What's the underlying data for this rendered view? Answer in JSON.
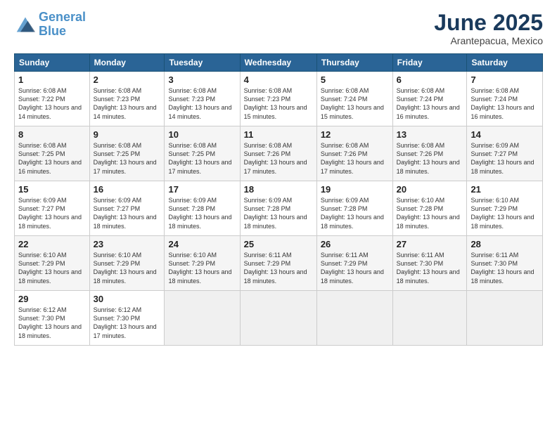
{
  "logo": {
    "line1": "General",
    "line2": "Blue"
  },
  "title": "June 2025",
  "subtitle": "Arantepacua, Mexico",
  "days_of_week": [
    "Sunday",
    "Monday",
    "Tuesday",
    "Wednesday",
    "Thursday",
    "Friday",
    "Saturday"
  ],
  "weeks": [
    [
      {
        "day": "1",
        "sunrise": "Sunrise: 6:08 AM",
        "sunset": "Sunset: 7:22 PM",
        "daylight": "Daylight: 13 hours and 14 minutes."
      },
      {
        "day": "2",
        "sunrise": "Sunrise: 6:08 AM",
        "sunset": "Sunset: 7:23 PM",
        "daylight": "Daylight: 13 hours and 14 minutes."
      },
      {
        "day": "3",
        "sunrise": "Sunrise: 6:08 AM",
        "sunset": "Sunset: 7:23 PM",
        "daylight": "Daylight: 13 hours and 14 minutes."
      },
      {
        "day": "4",
        "sunrise": "Sunrise: 6:08 AM",
        "sunset": "Sunset: 7:23 PM",
        "daylight": "Daylight: 13 hours and 15 minutes."
      },
      {
        "day": "5",
        "sunrise": "Sunrise: 6:08 AM",
        "sunset": "Sunset: 7:24 PM",
        "daylight": "Daylight: 13 hours and 15 minutes."
      },
      {
        "day": "6",
        "sunrise": "Sunrise: 6:08 AM",
        "sunset": "Sunset: 7:24 PM",
        "daylight": "Daylight: 13 hours and 16 minutes."
      },
      {
        "day": "7",
        "sunrise": "Sunrise: 6:08 AM",
        "sunset": "Sunset: 7:24 PM",
        "daylight": "Daylight: 13 hours and 16 minutes."
      }
    ],
    [
      {
        "day": "8",
        "sunrise": "Sunrise: 6:08 AM",
        "sunset": "Sunset: 7:25 PM",
        "daylight": "Daylight: 13 hours and 16 minutes."
      },
      {
        "day": "9",
        "sunrise": "Sunrise: 6:08 AM",
        "sunset": "Sunset: 7:25 PM",
        "daylight": "Daylight: 13 hours and 17 minutes."
      },
      {
        "day": "10",
        "sunrise": "Sunrise: 6:08 AM",
        "sunset": "Sunset: 7:25 PM",
        "daylight": "Daylight: 13 hours and 17 minutes."
      },
      {
        "day": "11",
        "sunrise": "Sunrise: 6:08 AM",
        "sunset": "Sunset: 7:26 PM",
        "daylight": "Daylight: 13 hours and 17 minutes."
      },
      {
        "day": "12",
        "sunrise": "Sunrise: 6:08 AM",
        "sunset": "Sunset: 7:26 PM",
        "daylight": "Daylight: 13 hours and 17 minutes."
      },
      {
        "day": "13",
        "sunrise": "Sunrise: 6:08 AM",
        "sunset": "Sunset: 7:26 PM",
        "daylight": "Daylight: 13 hours and 18 minutes."
      },
      {
        "day": "14",
        "sunrise": "Sunrise: 6:09 AM",
        "sunset": "Sunset: 7:27 PM",
        "daylight": "Daylight: 13 hours and 18 minutes."
      }
    ],
    [
      {
        "day": "15",
        "sunrise": "Sunrise: 6:09 AM",
        "sunset": "Sunset: 7:27 PM",
        "daylight": "Daylight: 13 hours and 18 minutes."
      },
      {
        "day": "16",
        "sunrise": "Sunrise: 6:09 AM",
        "sunset": "Sunset: 7:27 PM",
        "daylight": "Daylight: 13 hours and 18 minutes."
      },
      {
        "day": "17",
        "sunrise": "Sunrise: 6:09 AM",
        "sunset": "Sunset: 7:28 PM",
        "daylight": "Daylight: 13 hours and 18 minutes."
      },
      {
        "day": "18",
        "sunrise": "Sunrise: 6:09 AM",
        "sunset": "Sunset: 7:28 PM",
        "daylight": "Daylight: 13 hours and 18 minutes."
      },
      {
        "day": "19",
        "sunrise": "Sunrise: 6:09 AM",
        "sunset": "Sunset: 7:28 PM",
        "daylight": "Daylight: 13 hours and 18 minutes."
      },
      {
        "day": "20",
        "sunrise": "Sunrise: 6:10 AM",
        "sunset": "Sunset: 7:28 PM",
        "daylight": "Daylight: 13 hours and 18 minutes."
      },
      {
        "day": "21",
        "sunrise": "Sunrise: 6:10 AM",
        "sunset": "Sunset: 7:29 PM",
        "daylight": "Daylight: 13 hours and 18 minutes."
      }
    ],
    [
      {
        "day": "22",
        "sunrise": "Sunrise: 6:10 AM",
        "sunset": "Sunset: 7:29 PM",
        "daylight": "Daylight: 13 hours and 18 minutes."
      },
      {
        "day": "23",
        "sunrise": "Sunrise: 6:10 AM",
        "sunset": "Sunset: 7:29 PM",
        "daylight": "Daylight: 13 hours and 18 minutes."
      },
      {
        "day": "24",
        "sunrise": "Sunrise: 6:10 AM",
        "sunset": "Sunset: 7:29 PM",
        "daylight": "Daylight: 13 hours and 18 minutes."
      },
      {
        "day": "25",
        "sunrise": "Sunrise: 6:11 AM",
        "sunset": "Sunset: 7:29 PM",
        "daylight": "Daylight: 13 hours and 18 minutes."
      },
      {
        "day": "26",
        "sunrise": "Sunrise: 6:11 AM",
        "sunset": "Sunset: 7:29 PM",
        "daylight": "Daylight: 13 hours and 18 minutes."
      },
      {
        "day": "27",
        "sunrise": "Sunrise: 6:11 AM",
        "sunset": "Sunset: 7:30 PM",
        "daylight": "Daylight: 13 hours and 18 minutes."
      },
      {
        "day": "28",
        "sunrise": "Sunrise: 6:11 AM",
        "sunset": "Sunset: 7:30 PM",
        "daylight": "Daylight: 13 hours and 18 minutes."
      }
    ],
    [
      {
        "day": "29",
        "sunrise": "Sunrise: 6:12 AM",
        "sunset": "Sunset: 7:30 PM",
        "daylight": "Daylight: 13 hours and 18 minutes."
      },
      {
        "day": "30",
        "sunrise": "Sunrise: 6:12 AM",
        "sunset": "Sunset: 7:30 PM",
        "daylight": "Daylight: 13 hours and 17 minutes."
      },
      null,
      null,
      null,
      null,
      null
    ]
  ]
}
